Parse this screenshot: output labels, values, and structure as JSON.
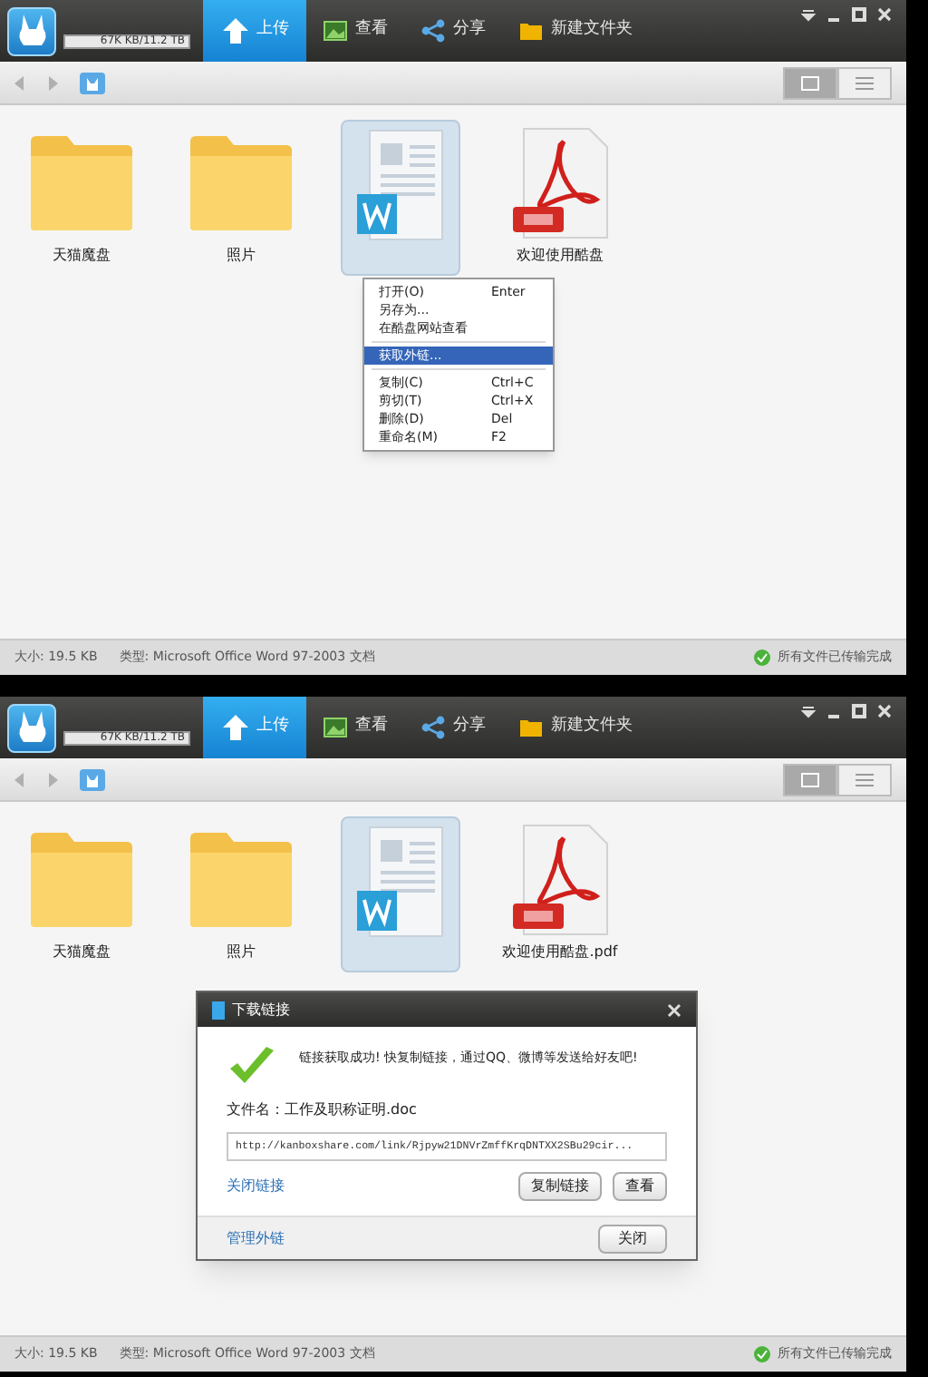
{
  "screens": [
    {
      "quota": "67K KB/11.2 TB",
      "toolbar": [
        {
          "label": "上传",
          "kind": "upload",
          "selected": true
        },
        {
          "label": "查看",
          "kind": "view",
          "selected": false
        },
        {
          "label": "分享",
          "kind": "share",
          "selected": false
        },
        {
          "label": "新建文件夹",
          "kind": "folder",
          "selected": false
        }
      ],
      "view_modes": [
        {
          "kind": "grid",
          "selected": true
        },
        {
          "kind": "list",
          "selected": false
        }
      ],
      "files": [
        {
          "kind": "folder",
          "name": "天猫魔盘",
          "selected": false
        },
        {
          "kind": "folder",
          "name": "照片",
          "selected": false
        },
        {
          "kind": "doc",
          "selected": true
        },
        {
          "kind": "pdf",
          "name": "欢迎使用酷盘",
          "selected": false
        }
      ],
      "context_menu": [
        {
          "kind": "item",
          "label": "打开(O)",
          "shortcut": "Enter",
          "selected": false
        },
        {
          "kind": "item",
          "label": "另存为...",
          "selected": false
        },
        {
          "kind": "item",
          "label": "在酷盘网站查看",
          "selected": false
        },
        {
          "kind": "separator"
        },
        {
          "kind": "item",
          "label": "获取外链...",
          "selected": true
        },
        {
          "kind": "separator"
        },
        {
          "kind": "item",
          "label": "复制(C)",
          "shortcut": "Ctrl+C",
          "selected": false
        },
        {
          "kind": "item",
          "label": "剪切(T)",
          "shortcut": "Ctrl+X",
          "selected": false
        },
        {
          "kind": "item",
          "label": "删除(D)",
          "shortcut": "Del",
          "selected": false
        },
        {
          "kind": "item",
          "label": "重命名(M)",
          "shortcut": "F2",
          "selected": false
        }
      ],
      "status": {
        "size": "大小: 19.5 KB",
        "type": "类型: Microsoft Office Word 97-2003 文档",
        "transfer": "所有文件已传输完成"
      }
    },
    {
      "quota": "67K KB/11.2 TB",
      "toolbar": [
        {
          "label": "上传",
          "kind": "upload",
          "selected": true
        },
        {
          "label": "查看",
          "kind": "view",
          "selected": false
        },
        {
          "label": "分享",
          "kind": "share",
          "selected": false
        },
        {
          "label": "新建文件夹",
          "kind": "folder",
          "selected": false
        }
      ],
      "view_modes": [
        {
          "kind": "grid",
          "selected": true
        },
        {
          "kind": "list",
          "selected": false
        }
      ],
      "files": [
        {
          "kind": "folder",
          "name": "天猫魔盘",
          "selected": false
        },
        {
          "kind": "folder",
          "name": "照片",
          "selected": false
        },
        {
          "kind": "doc",
          "selected": true
        },
        {
          "kind": "pdf",
          "name": "欢迎使用酷盘.pdf",
          "selected": false
        }
      ],
      "dialog": {
        "title": "下载链接",
        "message": "链接获取成功! 快复制链接，通过QQ、微博等发送给好友吧!",
        "filename": "文件名：工作及职称证明.doc",
        "url": "http://kanboxshare.com/link/Rjpyw21DNVrZmffKrqDNTXX2SBu29cir...",
        "close_link": "关闭链接",
        "buttons": [
          "复制链接",
          "查看"
        ],
        "manage_link": "管理外链",
        "close_button": "关闭"
      },
      "status": {
        "size": "大小: 19.5 KB",
        "type": "类型: Microsoft Office Word 97-2003 文档",
        "transfer": "所有文件已传输完成"
      }
    }
  ]
}
